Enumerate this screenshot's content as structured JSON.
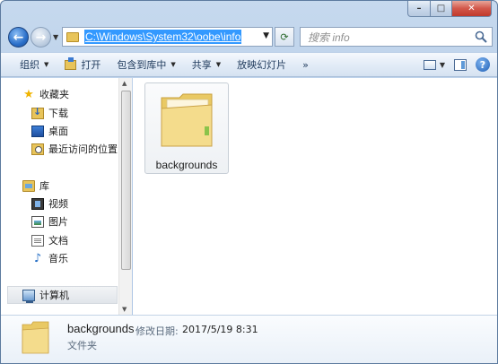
{
  "window": {
    "caption_buttons": {
      "minimize": "–",
      "maximize": "□",
      "close": "✕"
    }
  },
  "nav": {
    "back_glyph": "←",
    "forward_glyph": "→",
    "address_path": "C:\\Windows\\System32\\oobe\\info",
    "search_placeholder": "搜索 info"
  },
  "toolbar": {
    "items": [
      {
        "label": "组织",
        "has_dropdown": true
      },
      {
        "label": "打开",
        "has_dropdown": false
      },
      {
        "label": "包含到库中",
        "has_dropdown": true
      },
      {
        "label": "共享",
        "has_dropdown": true
      },
      {
        "label": "放映幻灯片",
        "has_dropdown": false
      },
      {
        "label": "»",
        "has_dropdown": false
      }
    ],
    "help_glyph": "?"
  },
  "sidebar": {
    "favorites": {
      "label": "收藏夹",
      "icon": "star-icon"
    },
    "favorites_items": [
      {
        "label": "下载",
        "icon": "downloads-icon"
      },
      {
        "label": "桌面",
        "icon": "desktop-icon"
      },
      {
        "label": "最近访问的位置",
        "icon": "recent-places-icon"
      }
    ],
    "libraries": {
      "label": "库",
      "icon": "library-icon"
    },
    "library_items": [
      {
        "label": "视频",
        "icon": "video-icon"
      },
      {
        "label": "图片",
        "icon": "pictures-icon"
      },
      {
        "label": "文档",
        "icon": "documents-icon"
      },
      {
        "label": "音乐",
        "icon": "music-icon"
      }
    ],
    "computer": {
      "label": "计算机",
      "icon": "computer-icon"
    }
  },
  "content": {
    "items": [
      {
        "name": "backgrounds",
        "icon": "folder-icon"
      }
    ]
  },
  "details": {
    "name": "backgrounds",
    "modified_label": "修改日期:",
    "modified_value": "2017/5/19 8:31",
    "type": "文件夹"
  }
}
